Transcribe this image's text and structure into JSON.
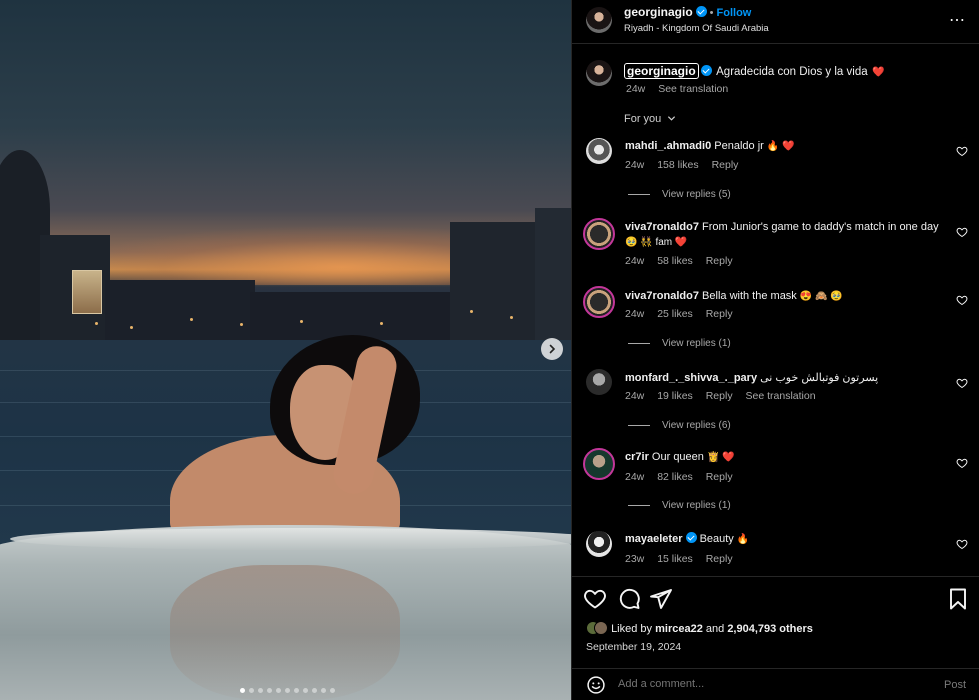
{
  "media": {
    "carousel_count": 11,
    "active_index": 0
  },
  "header": {
    "username": "georginagio",
    "separator": "•",
    "follow_label": "Follow",
    "location": "Riyadh - Kingdom Of Saudi Arabia",
    "more_glyph": "⋯"
  },
  "caption": {
    "username": "georginagio",
    "text": "Agradecida con Dios y la vida",
    "emoji": "❤️",
    "age": "24w",
    "see_translation": "See translation"
  },
  "for_you": "For you",
  "comments": [
    {
      "user": "mahdi_.ahmadi0",
      "text": "Penaldo jr",
      "emoji": "🔥 ❤️",
      "age": "24w",
      "likes": "158 likes",
      "reply": "Reply",
      "view_replies": "View replies (5)"
    },
    {
      "user": "viva7ronaldo7",
      "text": "From Junior's game to daddy's match in one day",
      "emoji": "🥹 👯 fam ❤️",
      "age": "24w",
      "likes": "58 likes",
      "reply": "Reply"
    },
    {
      "user": "viva7ronaldo7",
      "text": "Bella with the mask",
      "emoji": "😍 🙈 🥹",
      "age": "24w",
      "likes": "25 likes",
      "reply": "Reply",
      "view_replies": "View replies (1)"
    },
    {
      "user": "monfard_._shivva_._pary",
      "text": "پسرتون فوتبالش خوب نی",
      "age": "24w",
      "likes": "19 likes",
      "reply": "Reply",
      "see_translation": "See translation",
      "view_replies": "View replies (6)"
    },
    {
      "user": "cr7ir",
      "text": "Our queen",
      "emoji": "👸 ❤️",
      "age": "24w",
      "likes": "82 likes",
      "reply": "Reply",
      "view_replies": "View replies (1)"
    },
    {
      "user": "mayaeleter",
      "text": "Beauty",
      "emoji": "🔥",
      "age": "23w",
      "likes": "15 likes",
      "reply": "Reply"
    }
  ],
  "likes_summary": {
    "prefix": "Liked by",
    "user": "mircea22",
    "middle": "and",
    "count": "2,904,793 others"
  },
  "date": "September 19, 2024",
  "add_comment": {
    "placeholder": "Add a comment...",
    "post_label": "Post"
  },
  "colors": {
    "accent": "#0095f6",
    "background": "#000000",
    "muted": "#a8a8a8",
    "heart": "#ff3040",
    "story_ring": "#c3379a"
  }
}
